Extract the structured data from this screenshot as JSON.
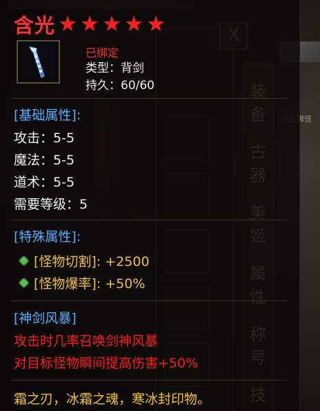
{
  "background": {
    "close_glyph": "X",
    "sidebar_chars": [
      "装",
      "备",
      "古",
      "器",
      "美",
      "姬",
      "属",
      "性",
      "称",
      "号",
      "技"
    ],
    "side_text": "金石狮怪"
  },
  "item": {
    "name": "含光",
    "stars": [
      "★",
      "★",
      "★",
      "★",
      "★"
    ],
    "icon": "blue-sword-icon",
    "bound": "已绑定",
    "type_line": "类型：背剑",
    "durability_line": "持久：60/60"
  },
  "base": {
    "header": "[基础属性]:",
    "attrs": [
      "攻击：5-5",
      "魔法：5-5",
      "道术：5-5",
      "需要等级：5"
    ]
  },
  "special": {
    "header": "[特殊属性]:",
    "attrs": [
      "[怪物切割]: +2500",
      "[怪物爆率]: +50%"
    ]
  },
  "skill": {
    "header": "[神剑风暴]",
    "lines": [
      "攻击时几率召唤剑神风暴",
      "对目标怪物瞬间提高伤害+50%"
    ]
  },
  "flavor": "霜之刃，冰霜之魂，寒冰封印物。",
  "colors": {
    "title": "#ff3030",
    "section": "#4fb0ff",
    "special": "#f1c232",
    "skill": "#ff1a1a",
    "flavor": "#f5c518"
  }
}
